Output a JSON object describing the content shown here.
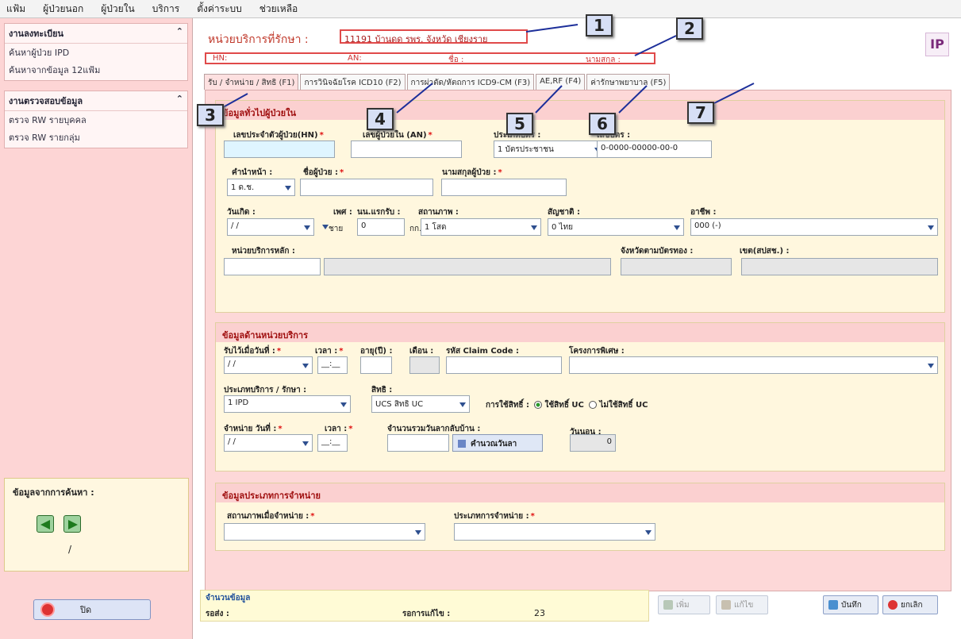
{
  "menu": [
    "แฟ้ม",
    "ผู้ป่วยนอก",
    "ผู้ป่วยใน",
    "บริการ",
    "ตั้งค่าระบบ",
    "ช่วยเหลือ"
  ],
  "sidebar": {
    "group1": {
      "title": "งานลงทะเบียน",
      "items": [
        "ค้นหาผู้ป่วย IPD",
        "ค้นหาจากข้อมูล 12แฟ้ม"
      ]
    },
    "group2": {
      "title": "งานตรวจสอบข้อมูล",
      "items": [
        "ตรวจ RW รายบุคคล",
        "ตรวจ RW รายกลุ่ม"
      ]
    },
    "search_title": "ข้อมูลจากการค้นหา :",
    "pager": "/",
    "close_label": "ปิด"
  },
  "header": {
    "title": "หน่วยบริการที่รักษา :",
    "hospital": "11191 บ้านดด รพร. จังหวัด เชียงราย",
    "hn_label": "HN:",
    "an_label": "AN:",
    "name_label": "ชื่อ :",
    "surname_label": "นามสกุล :",
    "ip_icon": "IP"
  },
  "tabs": [
    "รับ / จำหน่าย / สิทธิ (F1)",
    "การวินิจฉัยโรค ICD10 (F2)",
    "การผ่าตัด/หัตถการ ICD9-CM (F3)",
    "AE,RF (F4)",
    "ค่ารักษาพยาบาล (F5)"
  ],
  "sec1": {
    "title": "ข้อมูลทั่วไปผู้ป่วยใน",
    "hn_label": "เลขประจำตัวผู้ป่วย(HN)",
    "an_label": "เลขผู้ป่วยใน (AN)",
    "cardtype_label": "ประเภทบัตร :",
    "cardno_label": "เลขบัตร :",
    "cardtype_value": "1 บัตรประชาชน",
    "cardno_value": "0-0000-00000-00-0",
    "prefix_label": "คำนำหน้า :",
    "fname_label": "ชื่อผู้ป่วย :",
    "lname_label": "นามสกุลผู้ป่วย :",
    "prefix_value": "1 ด.ช.",
    "dob_label": "วันเกิด :",
    "sex_label": "เพศ :",
    "weight_label": "นน.แรกรับ :",
    "weight_unit": "กก.",
    "marital_label": "สถานภาพ :",
    "nation_label": "สัญชาติ :",
    "occ_label": "อาชีพ :",
    "dob_value": " /  /",
    "sex_value": "ชาย",
    "weight_value": "0",
    "marital_value": "1 โสด",
    "nation_value": "0 ไทย",
    "occ_value": "000 (-)",
    "mainunit_label": "หน่วยบริการหลัก :",
    "province_label": "จังหวัดตามบัตรทอง :",
    "zone_label": "เขต(สปสช.) :"
  },
  "sec2": {
    "title": "ข้อมูลด้านหน่วยบริการ",
    "admdate_label": "รับไว้เมื่อวันที่ :",
    "admtime_label": "เวลา :",
    "age_label": "อายุ(ปี) :",
    "month_label": "เดือน :",
    "claim_label": "รหัส Claim Code :",
    "project_label": "โครงการพิเศษ :",
    "admdate_value": " /  /",
    "admtime_value": "__:__",
    "svctype_label": "ประเภทบริการ / รักษา :",
    "right_label": "สิทธิ :",
    "svctype_value": "1 IPD",
    "right_value": "UCS สิทธิ UC",
    "useright_label": "การใช้สิทธิ์ :",
    "useright_opt1": "ใช้สิทธิ์ UC",
    "useright_opt2": "ไม่ใช้สิทธิ์ UC",
    "disdate_label": "จำหน่าย วันที่ :",
    "distime_label": "เวลา :",
    "leave_label": "จำนวนรวมวันลากลับบ้าน :",
    "los_label": "วันนอน :",
    "disdate_value": " /  /",
    "distime_value": "__:__",
    "calc_label": "คำนวณวันลา",
    "los_value": "0"
  },
  "sec3": {
    "title": "ข้อมูลประเภทการจำหน่าย",
    "status_label": "สถานภาพเมื่อจำหน่าย :",
    "type_label": "ประเภทการจำหน่าย :"
  },
  "footer": {
    "title": "จำนวนข้อมูล",
    "total_label": "รอส่ง :",
    "pending_label": "รอการแก้ไข :",
    "pending_value": "23"
  },
  "buttons": {
    "add": "เพิ่ม",
    "edit": "แก้ไข",
    "save": "บันทึก",
    "cancel": "ยกเลิก"
  },
  "callouts": [
    "1",
    "2",
    "3",
    "4",
    "5",
    "6",
    "7"
  ],
  "colors": {
    "sidebar": "#fdd5d5",
    "form": "#fdd8d8",
    "section": "#fff7de",
    "accent": "#c0392b",
    "callout": "#d7dff5"
  }
}
